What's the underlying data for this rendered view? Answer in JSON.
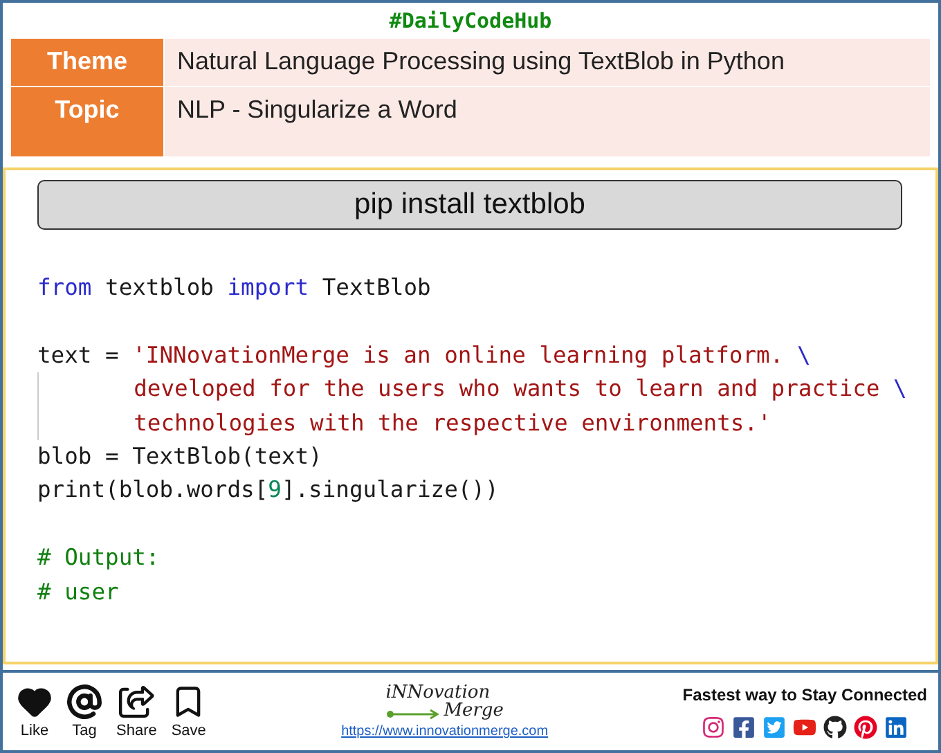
{
  "header": {
    "title": "#DailyCodeHub"
  },
  "info_rows": [
    {
      "label": "Theme",
      "value": "Natural Language Processing using TextBlob in Python"
    },
    {
      "label": "Topic",
      "value": "NLP - Singularize a Word"
    }
  ],
  "install_command": "pip install textblob",
  "code_lines": [
    {
      "kind": "code",
      "tokens": [
        {
          "kind": "keyword",
          "text": "from"
        },
        {
          "kind": "plain",
          "text": " textblob "
        },
        {
          "kind": "keyword",
          "text": "import"
        },
        {
          "kind": "plain",
          "text": " TextBlob"
        }
      ]
    },
    {
      "kind": "blank"
    },
    {
      "kind": "code",
      "tokens": [
        {
          "kind": "plain",
          "text": "text = "
        },
        {
          "kind": "string",
          "text": "'INNovationMerge is an online learning platform. "
        },
        {
          "kind": "escape",
          "text": "\\"
        }
      ]
    },
    {
      "kind": "continuation",
      "tokens": [
        {
          "kind": "string",
          "text": "developed for the users who wants to learn and practice "
        },
        {
          "kind": "escape",
          "text": "\\"
        }
      ]
    },
    {
      "kind": "continuation",
      "tokens": [
        {
          "kind": "string",
          "text": "technologies with the respective environments.'"
        }
      ]
    },
    {
      "kind": "code",
      "tokens": [
        {
          "kind": "plain",
          "text": "blob = TextBlob(text)"
        }
      ]
    },
    {
      "kind": "code",
      "tokens": [
        {
          "kind": "plain",
          "text": "print(blob.words["
        },
        {
          "kind": "number",
          "text": "9"
        },
        {
          "kind": "plain",
          "text": "].singularize())"
        }
      ]
    },
    {
      "kind": "blank"
    },
    {
      "kind": "code",
      "tokens": [
        {
          "kind": "comment",
          "text": "# Output:"
        }
      ]
    },
    {
      "kind": "code",
      "tokens": [
        {
          "kind": "comment",
          "text": "# user"
        }
      ]
    }
  ],
  "footer": {
    "actions": [
      {
        "kind": "like",
        "label": "Like"
      },
      {
        "kind": "tag",
        "label": "Tag"
      },
      {
        "kind": "share",
        "label": "Share"
      },
      {
        "kind": "save",
        "label": "Save"
      }
    ],
    "logo": {
      "line_1": "iNNovation",
      "line_2": "Merge"
    },
    "link": "https://www.innovationmerge.com",
    "tagline": "Fastest way to Stay Connected",
    "social": [
      {
        "kind": "instagram"
      },
      {
        "kind": "facebook"
      },
      {
        "kind": "twitter"
      },
      {
        "kind": "youtube"
      },
      {
        "kind": "github"
      },
      {
        "kind": "pinterest"
      },
      {
        "kind": "linkedin"
      }
    ]
  }
}
